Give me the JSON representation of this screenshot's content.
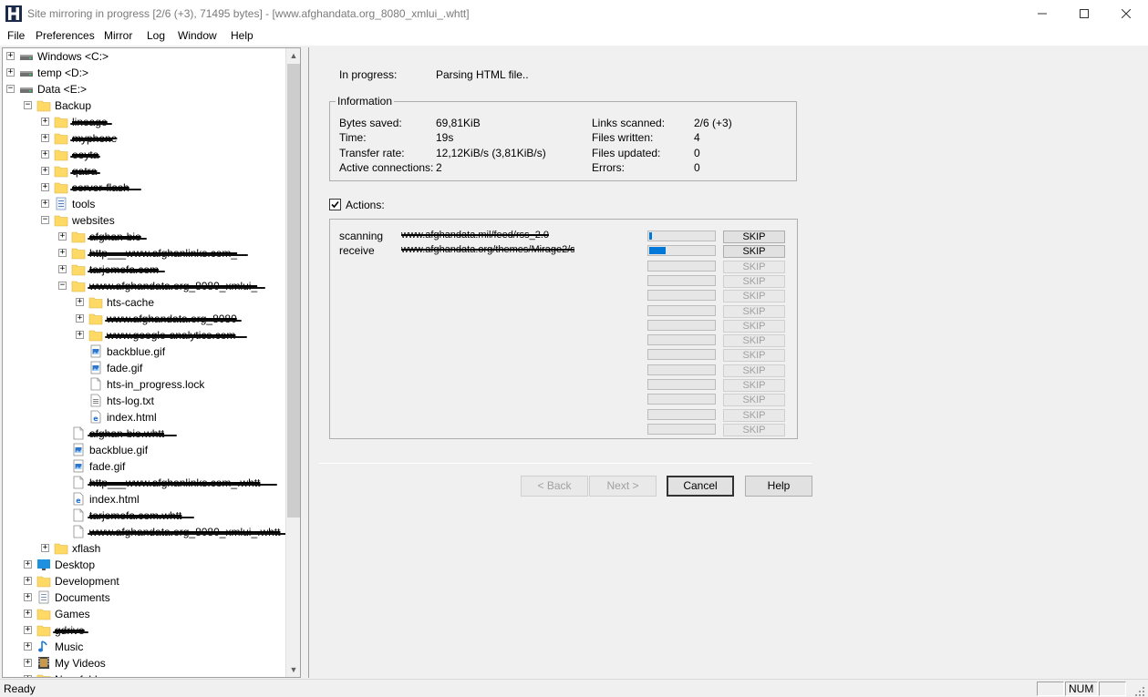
{
  "window": {
    "title": "Site mirroring in progress [2/6 (+3), 71495 bytes] - [www.afghandata.org_8080_xmlui_.whtt]"
  },
  "menu": [
    "File",
    "Preferences",
    "Mirror",
    "Log",
    "Window",
    "Help"
  ],
  "tree": [
    {
      "label": "Windows <C:>",
      "icon": "drive-icon",
      "expander": "+",
      "indent": 0
    },
    {
      "label": "temp <D:>",
      "icon": "drive-icon",
      "expander": "+",
      "indent": 0
    },
    {
      "label": "Data <E:>",
      "icon": "drive-icon",
      "expander": "-",
      "indent": 0
    },
    {
      "label": "Backup",
      "icon": "folder-icon",
      "expander": "-",
      "indent": 1
    },
    {
      "label": "lineage",
      "icon": "folder-icon",
      "expander": "+",
      "indent": 2,
      "redacted": true
    },
    {
      "label": "myphone",
      "icon": "folder-icon",
      "expander": "+",
      "indent": 2,
      "redacted": true
    },
    {
      "label": "ooyta",
      "icon": "folder-icon",
      "expander": "+",
      "indent": 2,
      "redacted": true
    },
    {
      "label": "qatra",
      "icon": "folder-icon",
      "expander": "+",
      "indent": 2,
      "redacted": true
    },
    {
      "label": "server-flash",
      "icon": "folder-icon",
      "expander": "+",
      "indent": 2,
      "redacted": true
    },
    {
      "label": "tools",
      "icon": "tools-icon",
      "expander": "+",
      "indent": 2
    },
    {
      "label": "websites",
      "icon": "folder-icon",
      "expander": "-",
      "indent": 2
    },
    {
      "label": "afghan-bio",
      "icon": "folder-icon",
      "expander": "+",
      "indent": 3,
      "redacted": true
    },
    {
      "label": "http___www.afghanlinks.com_",
      "icon": "folder-icon",
      "expander": "+",
      "indent": 3,
      "redacted": true
    },
    {
      "label": "tarjomefa.com",
      "icon": "folder-icon",
      "expander": "+",
      "indent": 3,
      "redacted": true
    },
    {
      "label": "www.afghandata.org_8080_xmlui_",
      "icon": "folder-icon",
      "expander": "-",
      "indent": 3,
      "redacted": true
    },
    {
      "label": "hts-cache",
      "icon": "folder-icon",
      "expander": "+",
      "indent": 4
    },
    {
      "label": "www.afghandata.org_8080",
      "icon": "folder-icon",
      "expander": "+",
      "indent": 4,
      "redacted": true
    },
    {
      "label": "www.google-analytics.com",
      "icon": "folder-icon",
      "expander": "+",
      "indent": 4,
      "redacted": true
    },
    {
      "label": "backblue.gif",
      "icon": "image-file-icon",
      "expander": "",
      "indent": 4
    },
    {
      "label": "fade.gif",
      "icon": "image-file-icon",
      "expander": "",
      "indent": 4
    },
    {
      "label": "hts-in_progress.lock",
      "icon": "file-icon",
      "expander": "",
      "indent": 4
    },
    {
      "label": "hts-log.txt",
      "icon": "text-file-icon",
      "expander": "",
      "indent": 4
    },
    {
      "label": "index.html",
      "icon": "html-file-icon",
      "expander": "",
      "indent": 4
    },
    {
      "label": "afghan-bio.whtt",
      "icon": "file-icon",
      "expander": "",
      "indent": 3,
      "redacted": true
    },
    {
      "label": "backblue.gif",
      "icon": "image-file-icon",
      "expander": "",
      "indent": 3
    },
    {
      "label": "fade.gif",
      "icon": "image-file-icon",
      "expander": "",
      "indent": 3
    },
    {
      "label": "http___www.afghanlinks.com_.whtt",
      "icon": "file-icon",
      "expander": "",
      "indent": 3,
      "redacted": true
    },
    {
      "label": "index.html",
      "icon": "html-file-icon",
      "expander": "",
      "indent": 3
    },
    {
      "label": "tarjomefa.com.whtt",
      "icon": "file-icon",
      "expander": "",
      "indent": 3,
      "redacted": true
    },
    {
      "label": "www.afghandata.org_8080_xmlui_.whtt",
      "icon": "file-icon",
      "expander": "",
      "indent": 3,
      "redacted": true
    },
    {
      "label": "xflash",
      "icon": "folder-icon",
      "expander": "+",
      "indent": 2
    },
    {
      "label": "Desktop",
      "icon": "desktop-icon",
      "expander": "+",
      "indent": 1
    },
    {
      "label": "Development",
      "icon": "folder-icon",
      "expander": "+",
      "indent": 1
    },
    {
      "label": "Documents",
      "icon": "documents-icon",
      "expander": "+",
      "indent": 1
    },
    {
      "label": "Games",
      "icon": "folder-icon",
      "expander": "+",
      "indent": 1
    },
    {
      "label": "gdrive",
      "icon": "folder-icon",
      "expander": "+",
      "indent": 1,
      "redacted": true
    },
    {
      "label": "Music",
      "icon": "music-icon",
      "expander": "+",
      "indent": 1
    },
    {
      "label": "My Videos",
      "icon": "videos-icon",
      "expander": "+",
      "indent": 1
    },
    {
      "label": "New folder",
      "icon": "folder-icon",
      "expander": "+",
      "indent": 1
    }
  ],
  "progress": {
    "in_progress_label": "In progress:",
    "in_progress_value": "Parsing HTML file..",
    "information_title": "Information",
    "bytes_saved_label": "Bytes saved:",
    "bytes_saved_value": "69,81KiB",
    "time_label": "Time:",
    "time_value": "19s",
    "transfer_rate_label": "Transfer rate:",
    "transfer_rate_value": "12,12KiB/s (3,81KiB/s)",
    "active_connections_label": "Active connections:",
    "active_connections_value": "2",
    "links_scanned_label": "Links scanned:",
    "links_scanned_value": "2/6 (+3)",
    "files_written_label": "Files written:",
    "files_written_value": "4",
    "files_updated_label": "Files updated:",
    "files_updated_value": "0",
    "errors_label": "Errors:",
    "errors_value": "0",
    "actions_label": "Actions:",
    "actions_checked": true
  },
  "actions": [
    {
      "status": "scanning",
      "url": "www.afghandata.mil/feed/rss_2.0",
      "progress": 0.02,
      "skip": "SKIP",
      "enabled": true
    },
    {
      "status": "receive",
      "url": "www.afghandata.org/themes/Mirage2/styles/main.css",
      "progress": 0.25,
      "skip": "SKIP",
      "enabled": true
    },
    {
      "status": "",
      "url": "",
      "progress": 0,
      "skip": "SKIP",
      "enabled": false
    },
    {
      "status": "",
      "url": "",
      "progress": 0,
      "skip": "SKIP",
      "enabled": false
    },
    {
      "status": "",
      "url": "",
      "progress": 0,
      "skip": "SKIP",
      "enabled": false
    },
    {
      "status": "",
      "url": "",
      "progress": 0,
      "skip": "SKIP",
      "enabled": false
    },
    {
      "status": "",
      "url": "",
      "progress": 0,
      "skip": "SKIP",
      "enabled": false
    },
    {
      "status": "",
      "url": "",
      "progress": 0,
      "skip": "SKIP",
      "enabled": false
    },
    {
      "status": "",
      "url": "",
      "progress": 0,
      "skip": "SKIP",
      "enabled": false
    },
    {
      "status": "",
      "url": "",
      "progress": 0,
      "skip": "SKIP",
      "enabled": false
    },
    {
      "status": "",
      "url": "",
      "progress": 0,
      "skip": "SKIP",
      "enabled": false
    },
    {
      "status": "",
      "url": "",
      "progress": 0,
      "skip": "SKIP",
      "enabled": false
    },
    {
      "status": "",
      "url": "",
      "progress": 0,
      "skip": "SKIP",
      "enabled": false
    },
    {
      "status": "",
      "url": "",
      "progress": 0,
      "skip": "SKIP",
      "enabled": false
    }
  ],
  "buttons": {
    "back": "< Back",
    "next": "Next >",
    "cancel": "Cancel",
    "help": "Help"
  },
  "status": {
    "text": "Ready",
    "num": "NUM"
  },
  "colors": {
    "accent": "#0078d7",
    "folder": "#ffd966"
  }
}
